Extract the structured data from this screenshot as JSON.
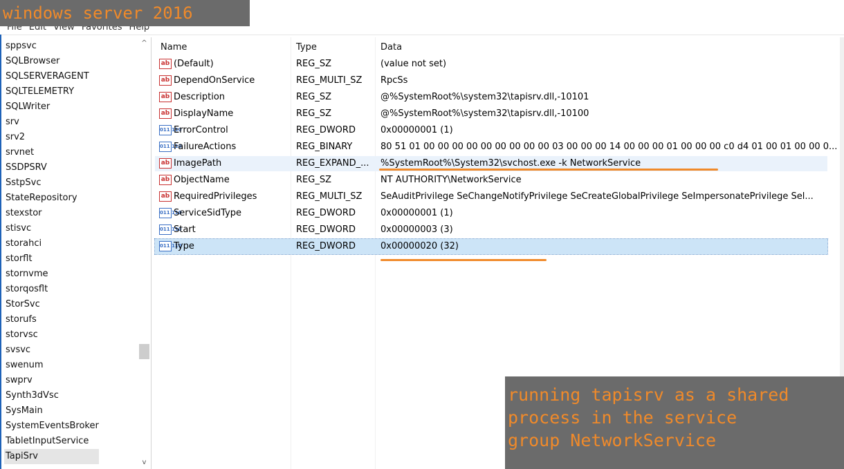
{
  "overlay_title": "windows server 2016",
  "menu": [
    "File",
    "Edit",
    "View",
    "Favorites",
    "Help"
  ],
  "tree_items": [
    "sppsvc",
    "SQLBrowser",
    "SQLSERVERAGENT",
    "SQLTELEMETRY",
    "SQLWriter",
    "srv",
    "srv2",
    "srvnet",
    "SSDPSRV",
    "SstpSvc",
    "StateRepository",
    "stexstor",
    "stisvc",
    "storahci",
    "storflt",
    "stornvme",
    "storqosflt",
    "StorSvc",
    "storufs",
    "storvsc",
    "svsvc",
    "swenum",
    "swprv",
    "Synth3dVsc",
    "SysMain",
    "SystemEventsBroker",
    "TabletInputService",
    "TapiSrv"
  ],
  "selected_tree_item": "TapiSrv",
  "columns": {
    "name": "Name",
    "type": "Type",
    "data": "Data"
  },
  "values": [
    {
      "icon": "ab",
      "name": "(Default)",
      "type": "REG_SZ",
      "data": "(value not set)"
    },
    {
      "icon": "ab",
      "name": "DependOnService",
      "type": "REG_MULTI_SZ",
      "data": "RpcSs"
    },
    {
      "icon": "ab",
      "name": "Description",
      "type": "REG_SZ",
      "data": "@%SystemRoot%\\system32\\tapisrv.dll,-10101"
    },
    {
      "icon": "ab",
      "name": "DisplayName",
      "type": "REG_SZ",
      "data": "@%SystemRoot%\\system32\\tapisrv.dll,-10100"
    },
    {
      "icon": "bin",
      "name": "ErrorControl",
      "type": "REG_DWORD",
      "data": "0x00000001 (1)"
    },
    {
      "icon": "bin",
      "name": "FailureActions",
      "type": "REG_BINARY",
      "data": "80 51 01 00 00 00 00 00 00 00 00 00 03 00 00 00 14 00 00 00 01 00 00 00 c0 d4 01 00 01 00 00 0..."
    },
    {
      "icon": "ab",
      "name": "ImagePath",
      "type": "REG_EXPAND_...",
      "data": "%SystemRoot%\\System32\\svchost.exe -k NetworkService"
    },
    {
      "icon": "ab",
      "name": "ObjectName",
      "type": "REG_SZ",
      "data": "NT AUTHORITY\\NetworkService"
    },
    {
      "icon": "ab",
      "name": "RequiredPrivileges",
      "type": "REG_MULTI_SZ",
      "data": "SeAuditPrivilege SeChangeNotifyPrivilege SeCreateGlobalPrivilege SeImpersonatePrivilege Sel..."
    },
    {
      "icon": "bin",
      "name": "ServiceSidType",
      "type": "REG_DWORD",
      "data": "0x00000001 (1)"
    },
    {
      "icon": "bin",
      "name": "Start",
      "type": "REG_DWORD",
      "data": "0x00000003 (3)"
    },
    {
      "icon": "bin",
      "name": "Type",
      "type": "REG_DWORD",
      "data": "0x00000020 (32)"
    }
  ],
  "icon_labels": {
    "ab": "ab",
    "bin": "011 110"
  },
  "note_lines": [
    "running tapisrv as a shared",
    "process in the service",
    "group NetworkService"
  ],
  "colors": {
    "annotation": "#f08a2a",
    "overlay_bg": "#6b6b6b",
    "selection": "#cce4f7"
  }
}
